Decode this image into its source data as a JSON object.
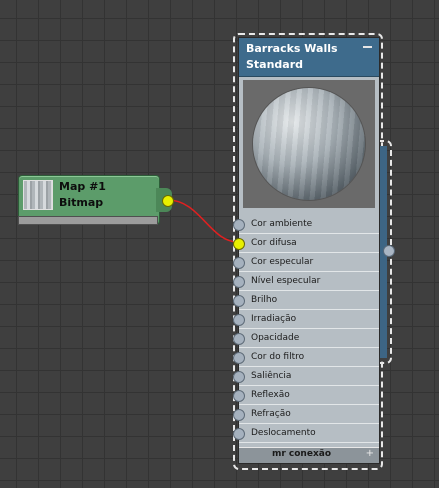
{
  "bitmap_node": {
    "title": "Map #1",
    "type": "Bitmap"
  },
  "material_node": {
    "name": "Barracks Walls",
    "type": "Standard",
    "slots": [
      {
        "label": "Cor ambiente",
        "connected": false
      },
      {
        "label": "Cor difusa",
        "connected": true
      },
      {
        "label": "Cor especular",
        "connected": false
      },
      {
        "label": "Nível especular",
        "connected": false
      },
      {
        "label": "Brilho",
        "connected": false
      },
      {
        "label": "Irradiação",
        "connected": false
      },
      {
        "label": "Opacidade",
        "connected": false
      },
      {
        "label": "Cor do filtro",
        "connected": false
      },
      {
        "label": "Saliência",
        "connected": false
      },
      {
        "label": "Reflexão",
        "connected": false
      },
      {
        "label": "Refração",
        "connected": false
      },
      {
        "label": "Deslocamento",
        "connected": false
      }
    ],
    "footer": "mr conexão",
    "footer_icon": "+"
  },
  "colors": {
    "canvas": "#3f3f3f",
    "material_header": "#3e6b8c",
    "bitmap_node": "#5c9c6a",
    "wire": "#e02020",
    "active_port": "#e8f000"
  }
}
